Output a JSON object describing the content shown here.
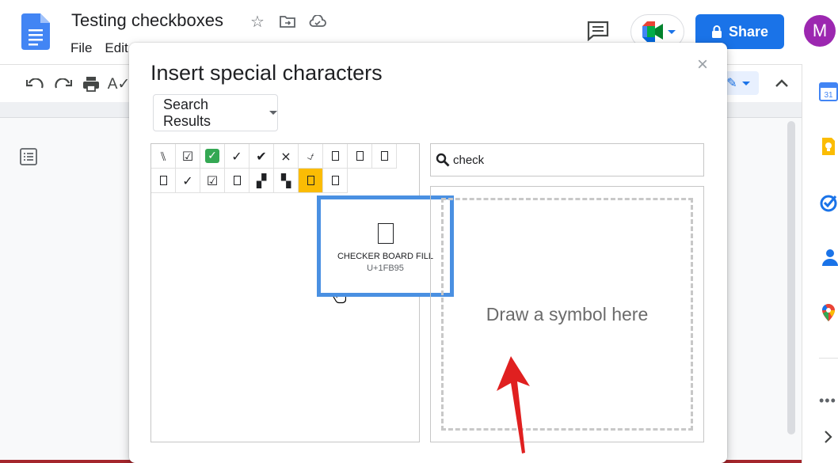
{
  "app": {
    "doc_title": "Testing checkboxes",
    "menu": [
      "File",
      "Edit"
    ],
    "share_label": "Share",
    "avatar_letter": "M"
  },
  "dialog": {
    "title": "Insert special characters",
    "close_glyph": "×",
    "category": "Search Results",
    "search_value": "check",
    "draw_placeholder": "Draw a symbol here",
    "characters": [
      {
        "glyph": "⑊",
        "kind": "text"
      },
      {
        "glyph": "☑",
        "kind": "text"
      },
      {
        "glyph": "✓",
        "kind": "green"
      },
      {
        "glyph": "✓",
        "kind": "text"
      },
      {
        "glyph": "✔",
        "kind": "text"
      },
      {
        "glyph": "×",
        "kind": "text"
      },
      {
        "glyph": "⍻",
        "kind": "text"
      },
      {
        "glyph": "",
        "kind": "box"
      },
      {
        "glyph": "",
        "kind": "box"
      },
      {
        "glyph": "",
        "kind": "box"
      },
      {
        "glyph": "",
        "kind": "box"
      },
      {
        "glyph": "✓",
        "kind": "text"
      },
      {
        "glyph": "☑",
        "kind": "text"
      },
      {
        "glyph": "",
        "kind": "box"
      },
      {
        "glyph": "▞",
        "kind": "text"
      },
      {
        "glyph": "▚",
        "kind": "text"
      },
      {
        "glyph": "",
        "kind": "box-selected"
      },
      {
        "glyph": "",
        "kind": "box"
      }
    ],
    "preview": {
      "name": "CHECKER BOARD FILL",
      "code": "U+1FB95"
    }
  },
  "colors": {
    "share_blue": "#1a73e8",
    "selected_cell": "#fbbc04",
    "preview_border": "#4a90e2",
    "arrow_red": "#e02020"
  }
}
